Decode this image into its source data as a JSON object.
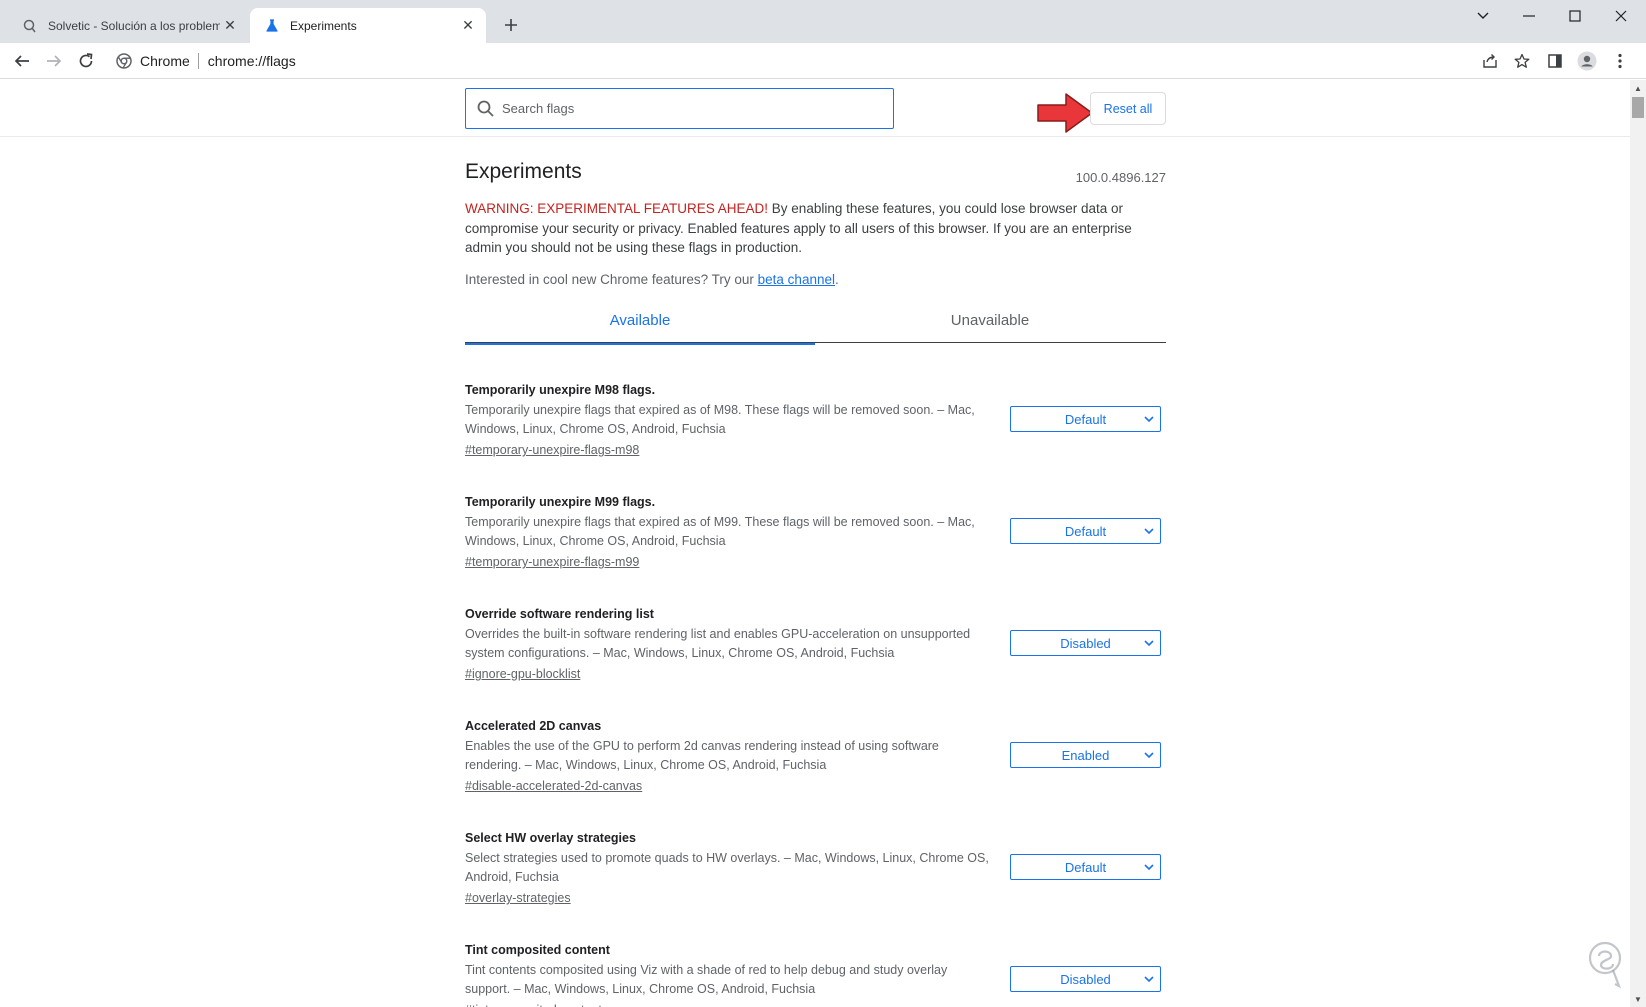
{
  "browser": {
    "tabs": [
      {
        "title": "Solvetic - Solución a los problemas",
        "active": false
      },
      {
        "title": "Experiments",
        "active": true
      }
    ],
    "omnibox": {
      "site": "Chrome",
      "url": "chrome://flags"
    }
  },
  "search": {
    "placeholder": "Search flags"
  },
  "reset_label": "Reset all",
  "page": {
    "title": "Experiments",
    "version": "100.0.4896.127",
    "warning_prefix": "WARNING: EXPERIMENTAL FEATURES AHEAD!",
    "warning_text": " By enabling these features, you could lose browser data or compromise your security or privacy. Enabled features apply to all users of this browser. If you are an enterprise admin you should not be using these flags in production.",
    "interested_text": "Interested in cool new Chrome features? Try our ",
    "beta_link": "beta channel",
    "interested_end": ".",
    "tabs": {
      "available": "Available",
      "unavailable": "Unavailable"
    }
  },
  "flags": [
    {
      "name": "Temporarily unexpire M98 flags.",
      "desc": "Temporarily unexpire flags that expired as of M98. These flags will be removed soon. – Mac, Windows, Linux, Chrome OS, Android, Fuchsia",
      "id": "#temporary-unexpire-flags-m98",
      "value": "Default"
    },
    {
      "name": "Temporarily unexpire M99 flags.",
      "desc": "Temporarily unexpire flags that expired as of M99. These flags will be removed soon. – Mac, Windows, Linux, Chrome OS, Android, Fuchsia",
      "id": "#temporary-unexpire-flags-m99",
      "value": "Default"
    },
    {
      "name": "Override software rendering list",
      "desc": "Overrides the built-in software rendering list and enables GPU-acceleration on unsupported system configurations. – Mac, Windows, Linux, Chrome OS, Android, Fuchsia",
      "id": "#ignore-gpu-blocklist",
      "value": "Disabled"
    },
    {
      "name": "Accelerated 2D canvas",
      "desc": "Enables the use of the GPU to perform 2d canvas rendering instead of using software rendering. – Mac, Windows, Linux, Chrome OS, Android, Fuchsia",
      "id": "#disable-accelerated-2d-canvas",
      "value": "Enabled"
    },
    {
      "name": "Select HW overlay strategies",
      "desc": "Select strategies used to promote quads to HW overlays. – Mac, Windows, Linux, Chrome OS, Android, Fuchsia",
      "id": "#overlay-strategies",
      "value": "Default"
    },
    {
      "name": "Tint composited content",
      "desc": "Tint contents composited using Viz with a shade of red to help debug and study overlay support. – Mac, Windows, Linux, Chrome OS, Android, Fuchsia",
      "id": "#tint-composited-content",
      "value": "Disabled"
    }
  ],
  "colors": {
    "accent": "#1a73e8",
    "warning": "#c5221f",
    "arrow": "#e8363a"
  }
}
